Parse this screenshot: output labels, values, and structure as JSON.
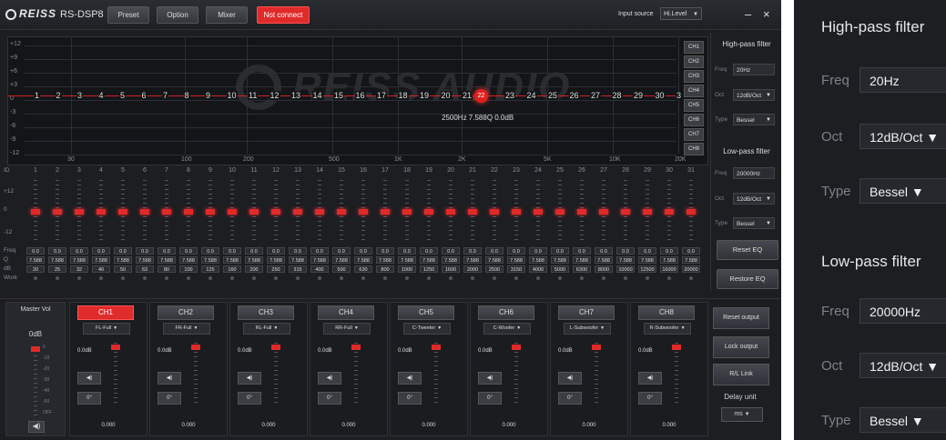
{
  "app": {
    "brand": "REISS",
    "brand_sub": "AUDIO",
    "model": "RS-DSP8",
    "menu": [
      "Preset",
      "Option",
      "Mixer"
    ],
    "connection_status": "Not connect",
    "input_source_label": "Input source",
    "input_source_value": "Hi.Level",
    "minimize": "–",
    "close": "×"
  },
  "graph": {
    "y_ticks": [
      "+12",
      "+9",
      "+6",
      "+3",
      "0",
      "-3",
      "-6",
      "-9",
      "-12"
    ],
    "x_ticks": [
      "30",
      "100",
      "200",
      "500",
      "1K",
      "2K",
      "5K",
      "10K",
      "20K"
    ],
    "band_numbers": [
      "1",
      "2",
      "3",
      "4",
      "5",
      "6",
      "7",
      "8",
      "9",
      "10",
      "11",
      "12",
      "13",
      "14",
      "15",
      "16",
      "17",
      "18",
      "19",
      "20",
      "21",
      "22",
      "23",
      "24",
      "25",
      "26",
      "27",
      "28",
      "29",
      "30",
      "3"
    ],
    "selected_band": "22",
    "selected_info": "2500Hz 7.588Q 0.0dB",
    "watermark": "REISS AUDIO",
    "channel_tags": [
      "CH1",
      "CH2",
      "CH3",
      "CH4",
      "CH5",
      "CH6",
      "CH7",
      "CH8"
    ]
  },
  "eq_bands": {
    "id_label": "ID",
    "scale_top": "+12",
    "scale_mid": "0",
    "scale_bottom": "-12",
    "ids": [
      "1",
      "2",
      "3",
      "4",
      "5",
      "6",
      "7",
      "8",
      "9",
      "10",
      "11",
      "12",
      "13",
      "14",
      "15",
      "16",
      "17",
      "18",
      "19",
      "20",
      "21",
      "22",
      "23",
      "24",
      "25",
      "26",
      "27",
      "28",
      "29",
      "30",
      "31"
    ],
    "row_labels": {
      "freq": "Freq",
      "q": "Q",
      "db": "dB",
      "work": "Work"
    },
    "gain_values": [
      "0.0",
      "0.0",
      "0.0",
      "0.0",
      "0.0",
      "0.0",
      "0.0",
      "0.0",
      "0.0",
      "0.0",
      "0.0",
      "0.0",
      "0.0",
      "0.0",
      "0.0",
      "0.0",
      "0.0",
      "0.0",
      "0.0",
      "0.0",
      "0.0",
      "0.0",
      "0.0",
      "0.0",
      "0.0",
      "0.0",
      "0.0",
      "0.0",
      "0.0",
      "0.0",
      "0.0"
    ],
    "q_values": [
      "7.588",
      "7.588",
      "7.588",
      "7.588",
      "7.588",
      "7.588",
      "7.588",
      "7.588",
      "7.588",
      "7.588",
      "7.588",
      "7.588",
      "7.588",
      "7.588",
      "7.588",
      "7.588",
      "7.588",
      "7.588",
      "7.588",
      "7.588",
      "7.588",
      "7.588",
      "7.588",
      "7.588",
      "7.588",
      "7.588",
      "7.588",
      "7.588",
      "7.588",
      "7.588",
      "7.588"
    ],
    "freq_values": [
      "20",
      "25",
      "32",
      "40",
      "50",
      "63",
      "80",
      "100",
      "125",
      "160",
      "200",
      "250",
      "315",
      "400",
      "500",
      "630",
      "800",
      "1000",
      "1250",
      "1600",
      "2000",
      "2500",
      "3150",
      "4000",
      "5000",
      "6300",
      "8000",
      "10000",
      "12500",
      "16000",
      "20000"
    ]
  },
  "high_pass": {
    "title": "High-pass filter",
    "freq_label": "Freq",
    "freq_value": "20Hz",
    "oct_label": "Oct",
    "oct_value": "12dB/Oct",
    "type_label": "Type",
    "type_value": "Bessel"
  },
  "low_pass": {
    "title": "Low-pass filter",
    "freq_label": "Freq",
    "freq_value": "20000Hz",
    "oct_label": "Oct",
    "oct_value": "12dB/Oct",
    "type_label": "Type",
    "type_value": "Bessel"
  },
  "eq_buttons": {
    "reset": "Reset EQ",
    "restore": "Restore EQ"
  },
  "master": {
    "label": "Master Vol",
    "value": "0dB",
    "scale": [
      "0",
      "-10",
      "-20",
      "-30",
      "-40",
      "-50",
      "OFF"
    ]
  },
  "channels": [
    {
      "name": "CH1",
      "output": "FL-Full",
      "gain": "0.0dB",
      "phase": "0°",
      "delay": "0.000",
      "active": true
    },
    {
      "name": "CH2",
      "output": "FR-Full",
      "gain": "0.0dB",
      "phase": "0°",
      "delay": "0.000",
      "active": false
    },
    {
      "name": "CH3",
      "output": "RL-Full",
      "gain": "0.0dB",
      "phase": "0°",
      "delay": "0.000",
      "active": false
    },
    {
      "name": "CH4",
      "output": "RR-Full",
      "gain": "0.0dB",
      "phase": "0°",
      "delay": "0.000",
      "active": false
    },
    {
      "name": "CH5",
      "output": "C-Tweeter",
      "gain": "0.0dB",
      "phase": "0°",
      "delay": "0.000",
      "active": false
    },
    {
      "name": "CH6",
      "output": "C-Woofer",
      "gain": "0.0dB",
      "phase": "0°",
      "delay": "0.000",
      "active": false
    },
    {
      "name": "CH7",
      "output": "L-Subwoofer",
      "gain": "0.0dB",
      "phase": "0°",
      "delay": "0.000",
      "active": false
    },
    {
      "name": "CH8",
      "output": "R-Subwoofer",
      "gain": "0.0dB",
      "phase": "0°",
      "delay": "0.000",
      "active": false
    }
  ],
  "output_buttons": {
    "reset": "Reset output",
    "lock": "Lock output",
    "rl_link": "R/L Link",
    "delay_unit_label": "Delay unit",
    "delay_unit_value": "ms"
  },
  "icons": {
    "speaker": "speaker-icon",
    "dropdown": "chevron-down-icon"
  },
  "colors": {
    "accent": "#e02b2b",
    "background": "#1c1e22",
    "panel": "#25282c"
  }
}
